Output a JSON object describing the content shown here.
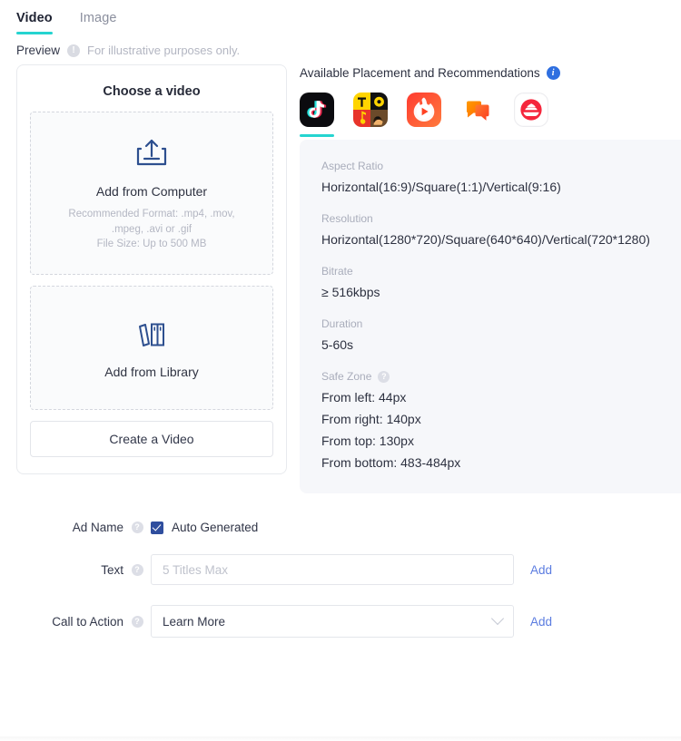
{
  "tabs": [
    {
      "label": "Video",
      "active": true
    },
    {
      "label": "Image",
      "active": false
    }
  ],
  "preview": {
    "label": "Preview",
    "icon": "exclamation-circle-icon",
    "note": "For illustrative purposes only."
  },
  "video_card": {
    "title": "Choose a video",
    "upload": {
      "icon": "upload-tray-icon",
      "label": "Add from Computer",
      "format_line1": "Recommended Format: .mp4, .mov,",
      "format_line2": ".mpeg, .avi or .gif",
      "filesize_line": "File Size: Up to 500 MB"
    },
    "library": {
      "icon": "books-library-icon",
      "label": "Add from Library"
    },
    "create_button": "Create a Video"
  },
  "placements": {
    "heading": "Available Placement and Recommendations",
    "info_icon": "info-circle-icon",
    "apps": [
      {
        "name": "tiktok",
        "label": "TikTok",
        "active": true
      },
      {
        "name": "topbuzz",
        "label": "TopBuzz",
        "active": false
      },
      {
        "name": "buzzvideo",
        "label": "BuzzVideo",
        "active": false
      },
      {
        "name": "babe",
        "label": "Babe",
        "active": false
      },
      {
        "name": "pangle",
        "label": "Pangle",
        "active": false
      }
    ]
  },
  "specs": {
    "aspect_ratio": {
      "key": "Aspect Ratio",
      "value": "Horizontal(16:9)/Square(1:1)/Vertical(9:16)"
    },
    "resolution": {
      "key": "Resolution",
      "value": "Horizontal(1280*720)/Square(640*640)/Vertical(720*1280)"
    },
    "bitrate": {
      "key": "Bitrate",
      "value": "≥ 516kbps"
    },
    "duration": {
      "key": "Duration",
      "value": "5-60s"
    },
    "safe_zone": {
      "key": "Safe Zone",
      "help_icon": "question-circle-icon",
      "from_left": "From left: 44px",
      "from_right": "From right: 140px",
      "from_top": "From top: 130px",
      "from_bottom": "From bottom: 483-484px"
    }
  },
  "form": {
    "ad_name": {
      "label": "Ad Name",
      "help_icon": "question-circle-icon",
      "checkbox_label": "Auto Generated",
      "checked": true
    },
    "text": {
      "label": "Text",
      "help_icon": "question-circle-icon",
      "value": "",
      "placeholder": "5 Titles Max",
      "add_label": "Add"
    },
    "call_to_action": {
      "label": "Call to Action",
      "help_icon": "question-circle-icon",
      "selected": "Learn More",
      "chevron_icon": "chevron-down-icon",
      "add_label": "Add"
    }
  },
  "colors": {
    "accent_teal": "#25d4d0",
    "link_blue": "#5b7ce0",
    "checkbox_blue": "#2f4e9e",
    "info_blue": "#2f6fe0",
    "panel_bg": "#f6f7fa"
  }
}
